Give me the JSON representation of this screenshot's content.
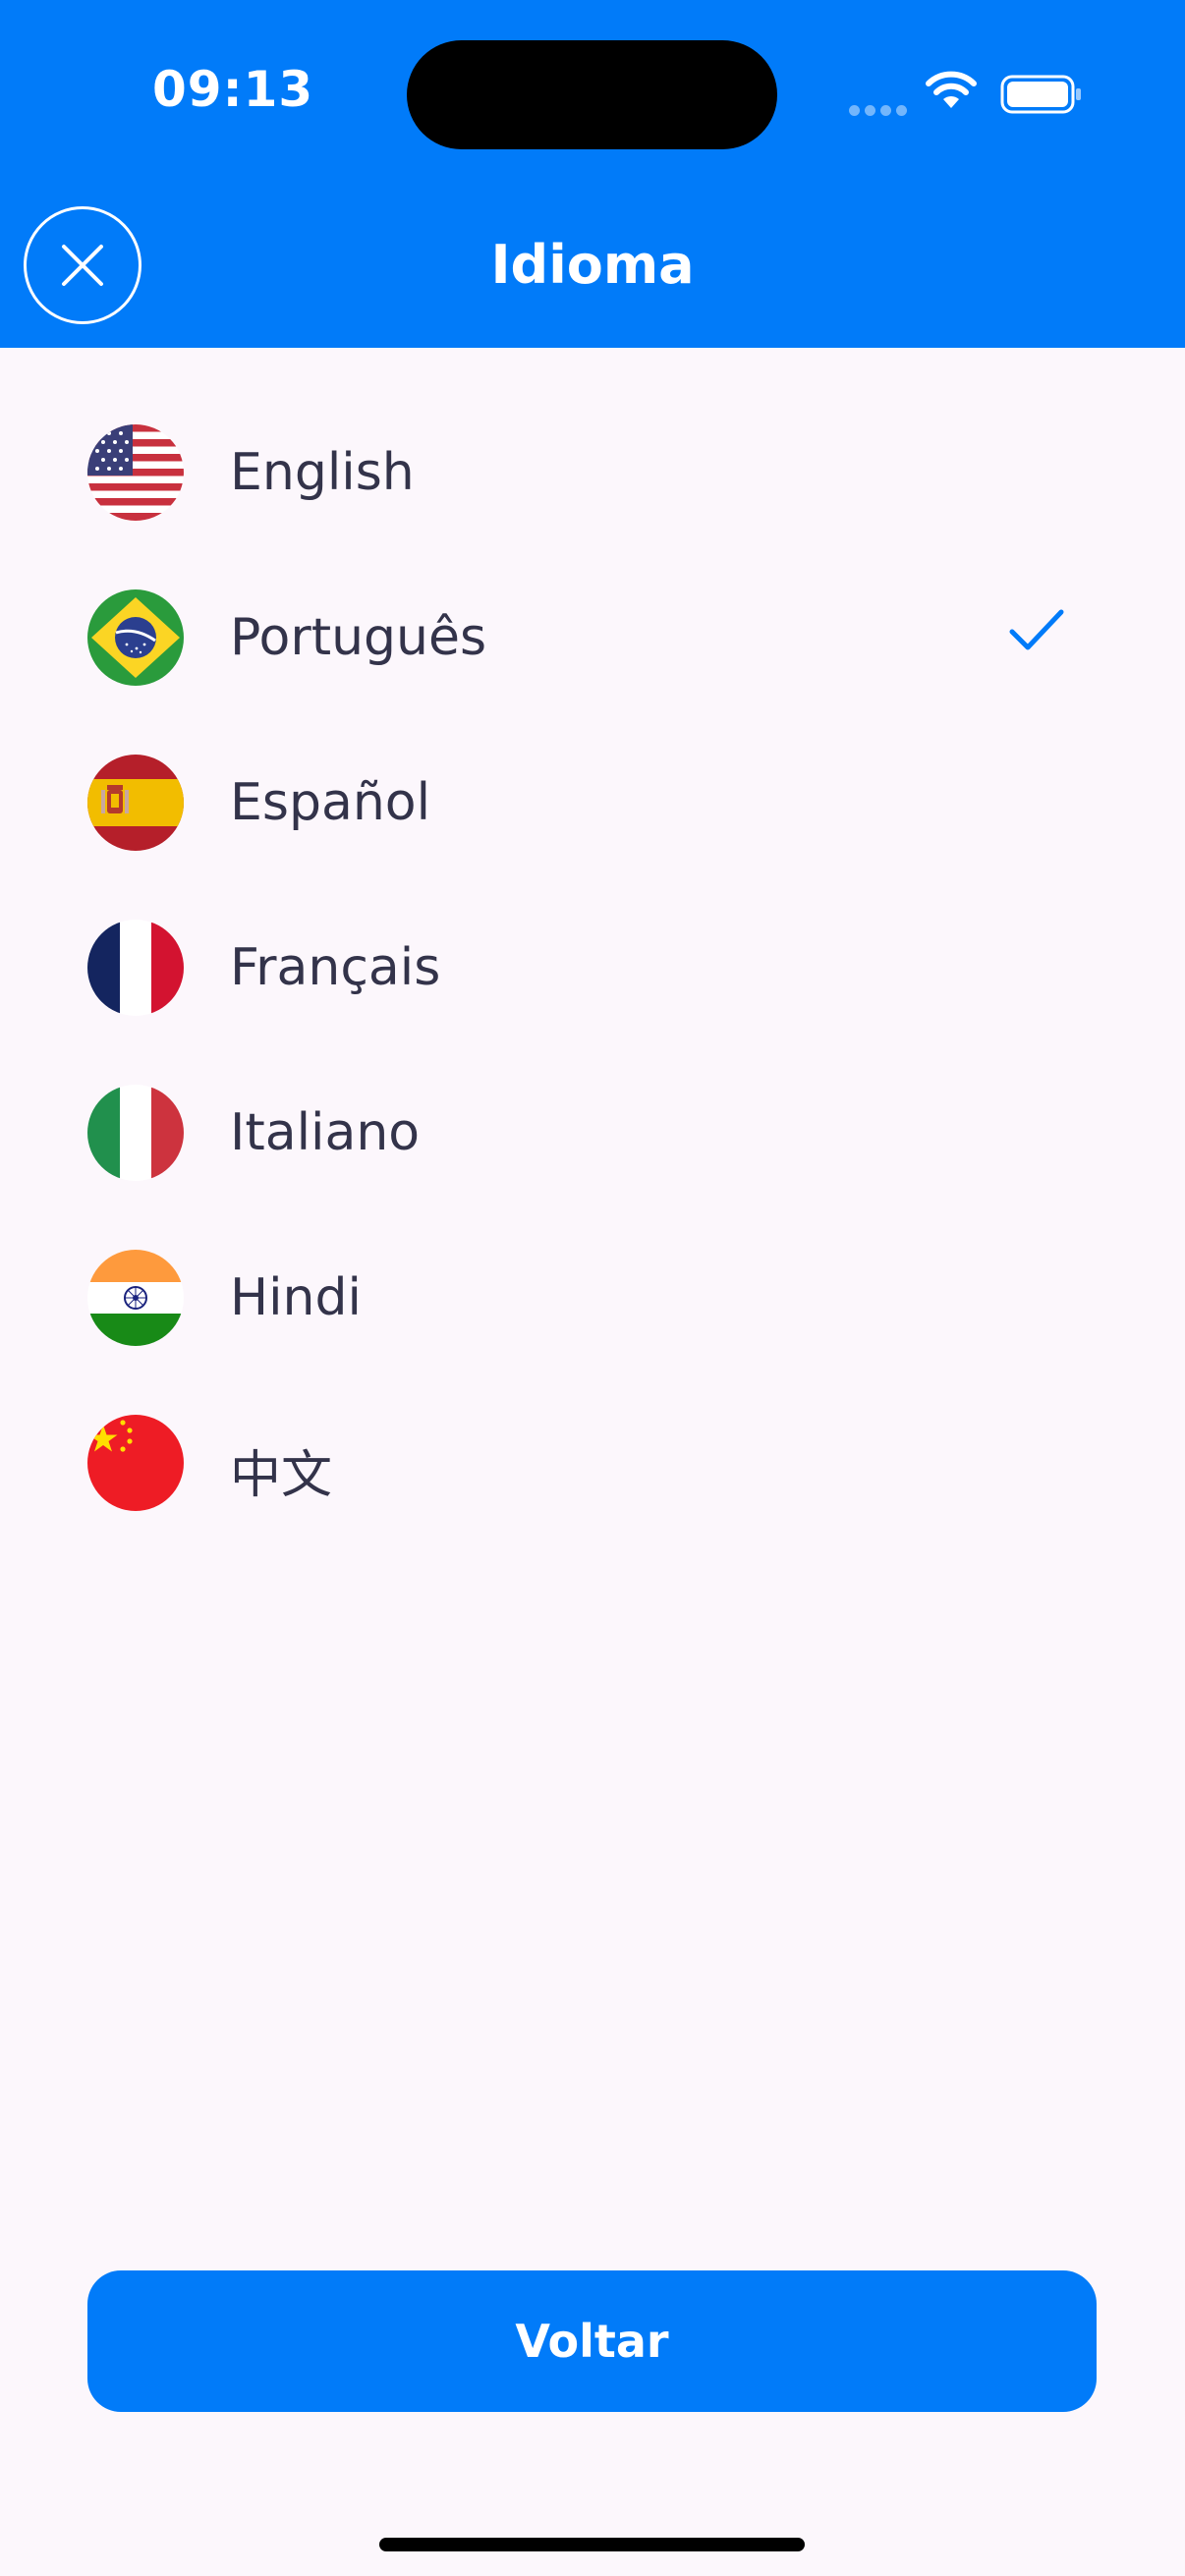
{
  "status_bar": {
    "time": "09:13"
  },
  "header": {
    "title": "Idioma",
    "close_icon": "close-icon"
  },
  "languages": [
    {
      "label": "English",
      "flag": "us-flag-icon",
      "selected": false
    },
    {
      "label": "Português",
      "flag": "brazil-flag-icon",
      "selected": true
    },
    {
      "label": "Español",
      "flag": "spain-flag-icon",
      "selected": false
    },
    {
      "label": "Français",
      "flag": "france-flag-icon",
      "selected": false
    },
    {
      "label": "Italiano",
      "flag": "italy-flag-icon",
      "selected": false
    },
    {
      "label": "Hindi",
      "flag": "india-flag-icon",
      "selected": false
    },
    {
      "label": "中文",
      "flag": "china-flag-icon",
      "selected": false
    }
  ],
  "footer": {
    "back_label": "Voltar"
  },
  "colors": {
    "accent": "#017bf9",
    "background": "#fcf7fc",
    "text": "#33334a"
  }
}
